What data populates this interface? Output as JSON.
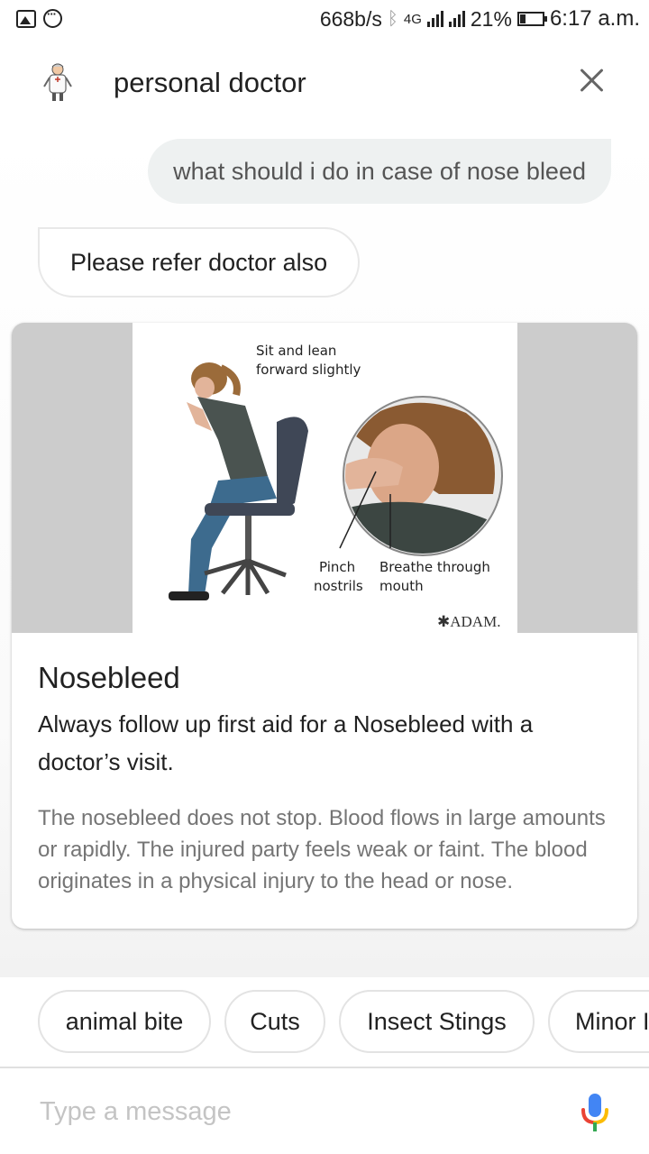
{
  "status_bar": {
    "speed": "668b/s",
    "network": "4G",
    "battery": "21%",
    "time": "6:17 a.m.",
    "icons": [
      "image-notification-icon",
      "chat-notification-icon",
      "bluetooth-icon",
      "signal-icon",
      "battery-icon"
    ]
  },
  "header": {
    "title": "personal doctor",
    "avatar_icon": "doctor-avatar",
    "close_icon": "close-icon"
  },
  "messages": {
    "user": "what should i do in case of nose bleed",
    "bot": "Please refer doctor also"
  },
  "card": {
    "image": {
      "label_sit": [
        "Sit and lean",
        "forward slightly"
      ],
      "label_pinch": [
        "Pinch",
        "nostrils"
      ],
      "label_breathe": [
        "Breathe through",
        "mouth"
      ],
      "brand": "ADAM."
    },
    "title": "Nosebleed",
    "subtitle": "Always follow up first aid for a Nosebleed with a doctor’s visit.",
    "description": "The nosebleed does not stop. Blood flows in large amounts or rapidly. The injured party feels weak or faint. The blood originates in a physical injury to the head or nose."
  },
  "chips": [
    "animal bite",
    "Cuts",
    "Insect Stings",
    "Minor I"
  ],
  "input": {
    "placeholder": "Type a message",
    "mic_icon": "microphone-icon"
  },
  "colors": {
    "user_bubble": "#eef1f1",
    "card_media_bg": "#cccccc",
    "muted_text": "#757575",
    "mic_blue": "#4285f4",
    "mic_red": "#ea4335",
    "mic_yellow": "#fbbc05",
    "mic_green": "#34a853"
  }
}
